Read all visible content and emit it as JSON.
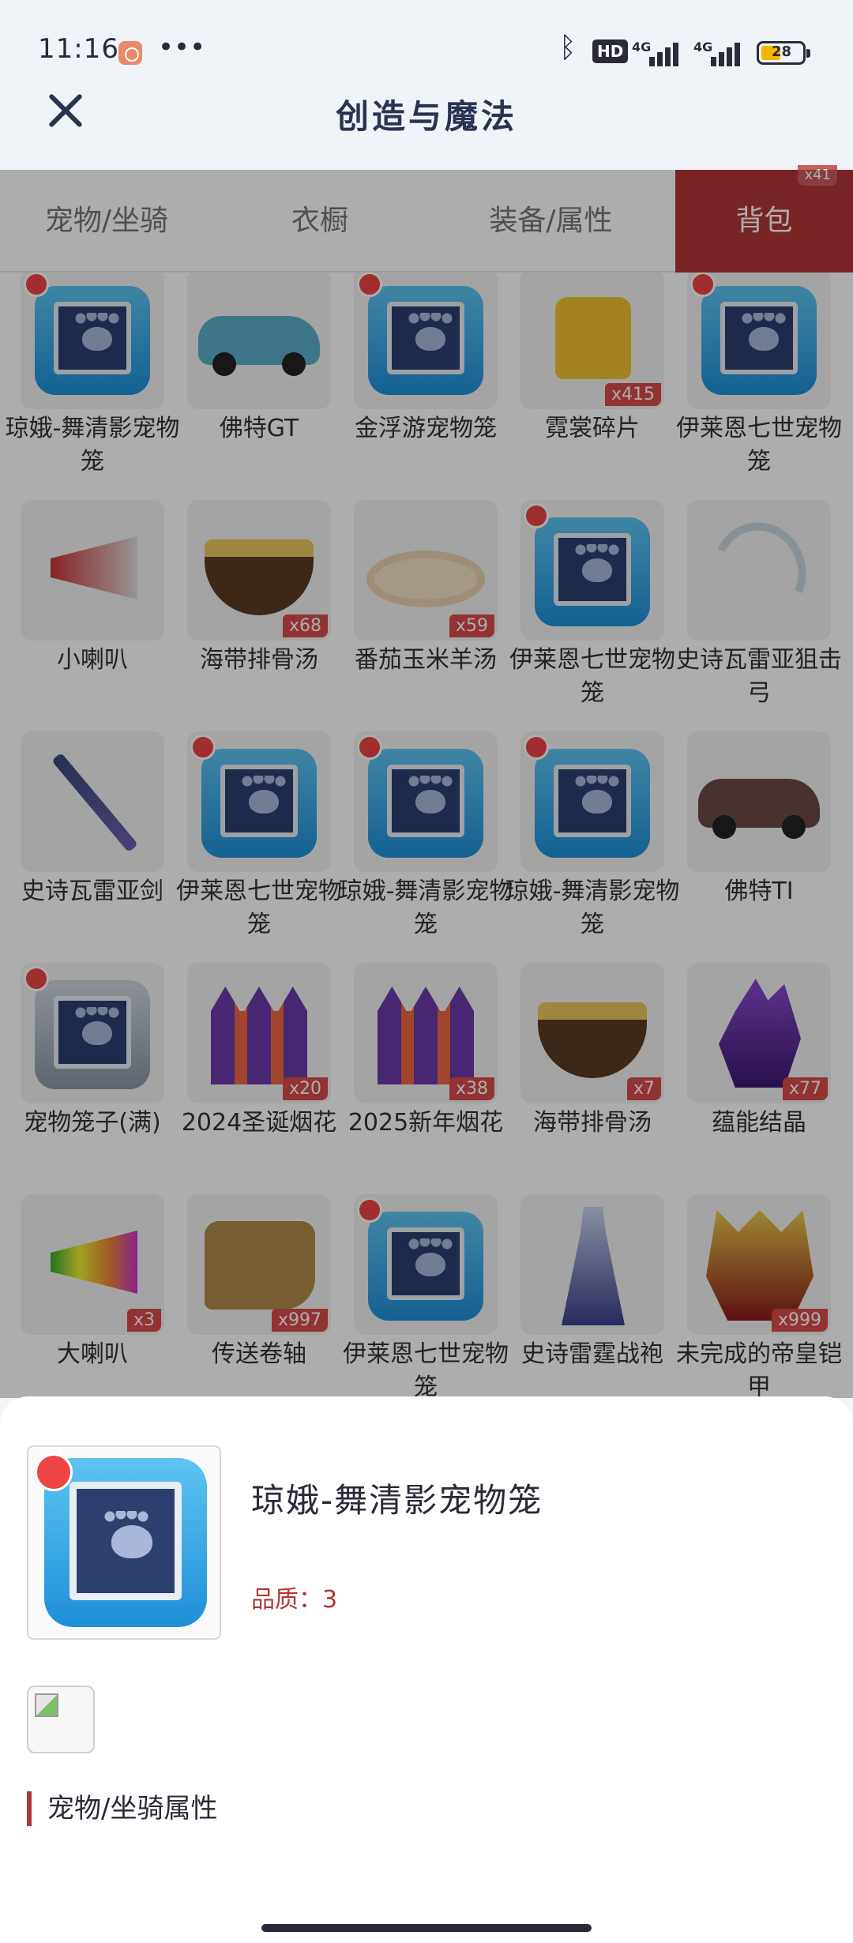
{
  "status_bar": {
    "time": "11:16",
    "dots": "•••",
    "hd": "HD",
    "sig1": "4G",
    "sig2": "4G",
    "battery": "28"
  },
  "header": {
    "title": "创造与魔法"
  },
  "tabs": [
    {
      "label": "宠物/坐骑"
    },
    {
      "label": "衣橱"
    },
    {
      "label": "装备/属性"
    },
    {
      "label": "背包",
      "count": "x41",
      "active": true
    }
  ],
  "items": [
    {
      "name": "琼娥-舞清影宠物笼",
      "icon": "pet-cage-icon",
      "qty": ""
    },
    {
      "name": "佛特GT",
      "icon": "car-icon",
      "qty": ""
    },
    {
      "name": "金浮游宠物笼",
      "icon": "pet-cage-icon",
      "qty": ""
    },
    {
      "name": "霓裳碎片",
      "icon": "shirt-icon",
      "qty": "x415"
    },
    {
      "name": "伊莱恩七世宠物笼",
      "icon": "pet-cage-icon",
      "qty": ""
    },
    {
      "name": "小喇叭",
      "icon": "megaphone-icon",
      "qty": ""
    },
    {
      "name": "海带排骨汤",
      "icon": "soup-bowl-icon",
      "qty": "x68"
    },
    {
      "name": "番茄玉米羊汤",
      "icon": "soup-dish-icon",
      "qty": "x59"
    },
    {
      "name": "伊莱恩七世宠物笼",
      "icon": "pet-cage-icon",
      "qty": ""
    },
    {
      "name": "史诗瓦雷亚狙击弓",
      "icon": "bow-icon",
      "qty": ""
    },
    {
      "name": "史诗瓦雷亚剑",
      "icon": "sword-icon",
      "qty": ""
    },
    {
      "name": "伊莱恩七世宠物笼",
      "icon": "pet-cage-icon",
      "qty": ""
    },
    {
      "name": "琼娥-舞清影宠物笼",
      "icon": "pet-cage-icon",
      "qty": ""
    },
    {
      "name": "琼娥-舞清影宠物笼",
      "icon": "pet-cage-icon",
      "qty": ""
    },
    {
      "name": "佛特TI",
      "icon": "car-icon",
      "qty": ""
    },
    {
      "name": "宠物笼子(满)",
      "icon": "pet-cage-icon",
      "qty": ""
    },
    {
      "name": "2024圣诞烟花",
      "icon": "fireworks-icon",
      "qty": "x20"
    },
    {
      "name": "2025新年烟花",
      "icon": "fireworks-icon",
      "qty": "x38"
    },
    {
      "name": "海带排骨汤",
      "icon": "soup-bowl-icon",
      "qty": "x7"
    },
    {
      "name": "蕴能结晶",
      "icon": "crystal-icon",
      "qty": "x77"
    },
    {
      "name": "大喇叭",
      "icon": "megaphone-icon",
      "qty": "x3"
    },
    {
      "name": "传送卷轴",
      "icon": "scroll-icon",
      "qty": "x997"
    },
    {
      "name": "伊莱恩七世宠物笼",
      "icon": "pet-cage-icon",
      "qty": ""
    },
    {
      "name": "史诗雷霆战袍",
      "icon": "robe-icon",
      "qty": ""
    },
    {
      "name": "未完成的帝皇铠甲",
      "icon": "armor-icon",
      "qty": "x999"
    }
  ],
  "detail": {
    "name": "琼娥-舞清影宠物笼",
    "quality": "品质：3",
    "section_title": "宠物/坐骑属性",
    "icon": "pet-cage-icon"
  }
}
